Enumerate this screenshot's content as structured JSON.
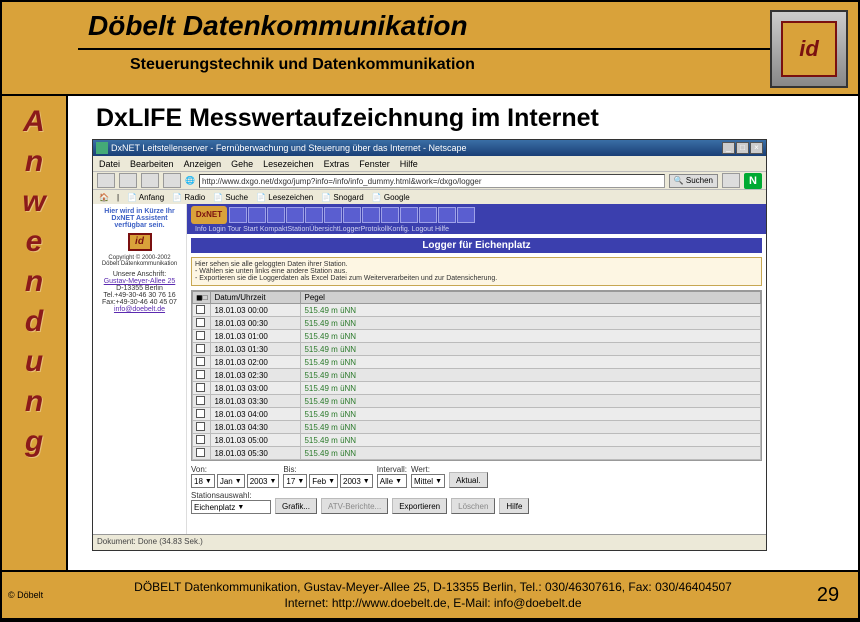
{
  "header": {
    "title": "Döbelt Datenkommunikation",
    "subtitle": "Steuerungstechnik und Datenkommunikation",
    "logo_text": "id"
  },
  "side_label": "Anwendung",
  "slide_title": "DxLIFE Messwertaufzeichnung im Internet",
  "browser": {
    "title": "DxNET Leitstellenserver - Fernüberwachung und Steuerung über das Internet - Netscape",
    "menu": [
      "Datei",
      "Bearbeiten",
      "Anzeigen",
      "Gehe",
      "Lesezeichen",
      "Extras",
      "Fenster",
      "Hilfe"
    ],
    "url": "http://www.dxgo.net/dxgo/jump?info=/info/info_dummy.html&work=/dxgo/logger",
    "go_label": "Suchen",
    "linkbar": [
      "Anfang",
      "Radio",
      "Suche",
      "Lesezeichen",
      "Snogard",
      "Google"
    ]
  },
  "page_side": {
    "assist": "Hier wird in Kürze Ihr\nDxNET Assistent\nverfügbar sein.",
    "logo": "id",
    "copyright": "Copyright © 2000-2002\nDöbelt Datenkommunikation",
    "addr_label": "Unsere Anschrift:",
    "addr_link": "Gustav-Meyer-Allee 25",
    "addr_city": "D-13355 Berlin",
    "tel": "Tel.+49-30-46 30 76 16",
    "fax": "Fax:+49-30-46 40 45 07",
    "email": "info@doebelt.de"
  },
  "dxnet_labels": "Info  Login  Tour   Start  KompaktStationÜbersichtLoggerProtokollKonfig. Logout  Hilfe",
  "panel_title": "Logger für Eichenplatz",
  "info_lines": [
    "Hier sehen sie alle geloggten Daten ihrer Station.",
    "- Wählen sie unten links eine andere Station aus.",
    "- Exportieren sie die Loggerdaten als Excel Datei zum Weiterverarbeiten und zur Datensicherung."
  ],
  "table": {
    "headers": [
      "",
      "Datum/Uhrzeit",
      "Pegel"
    ],
    "rows": [
      {
        "dt": "18.01.03 00:00",
        "pegel": "515.49 m üNN"
      },
      {
        "dt": "18.01.03 00:30",
        "pegel": "515.49 m üNN"
      },
      {
        "dt": "18.01.03 01:00",
        "pegel": "515.49 m üNN"
      },
      {
        "dt": "18.01.03 01:30",
        "pegel": "515.49 m üNN"
      },
      {
        "dt": "18.01.03 02:00",
        "pegel": "515.49 m üNN"
      },
      {
        "dt": "18.01.03 02:30",
        "pegel": "515.49 m üNN"
      },
      {
        "dt": "18.01.03 03:00",
        "pegel": "515.49 m üNN"
      },
      {
        "dt": "18.01.03 03:30",
        "pegel": "515.49 m üNN"
      },
      {
        "dt": "18.01.03 04:00",
        "pegel": "515.49 m üNN"
      },
      {
        "dt": "18.01.03 04:30",
        "pegel": "515.49 m üNN"
      },
      {
        "dt": "18.01.03 05:00",
        "pegel": "515.49 m üNN"
      },
      {
        "dt": "18.01.03 05:30",
        "pegel": "515.49 m üNN"
      }
    ]
  },
  "controls": {
    "von_label": "Von:",
    "von": {
      "d": "18",
      "m": "Jan",
      "y": "2003"
    },
    "bis_label": "Bis:",
    "bis": {
      "d": "17",
      "m": "Feb",
      "y": "2003"
    },
    "intervall_label": "Intervall:",
    "intervall": "Alle",
    "wert_label": "Wert:",
    "wert": "Mittel",
    "aktual": "Aktual.",
    "station_label": "Stationsauswahl:",
    "station": "Eichenplatz",
    "grafik": "Grafik...",
    "atv": "ATV-Berichte...",
    "export": "Exportieren",
    "loeschen": "Löschen",
    "hilfe": "Hilfe"
  },
  "statusbar": "Dokument: Done (34.83 Sek.)",
  "footer": {
    "copyright": "© Döbelt",
    "line1": "DÖBELT Datenkommunikation, Gustav-Meyer-Allee 25, D-13355 Berlin, Tel.: 030/46307616, Fax: 030/46404507",
    "line2": "Internet: http://www.doebelt.de, E-Mail: info@doebelt.de",
    "page": "29"
  }
}
